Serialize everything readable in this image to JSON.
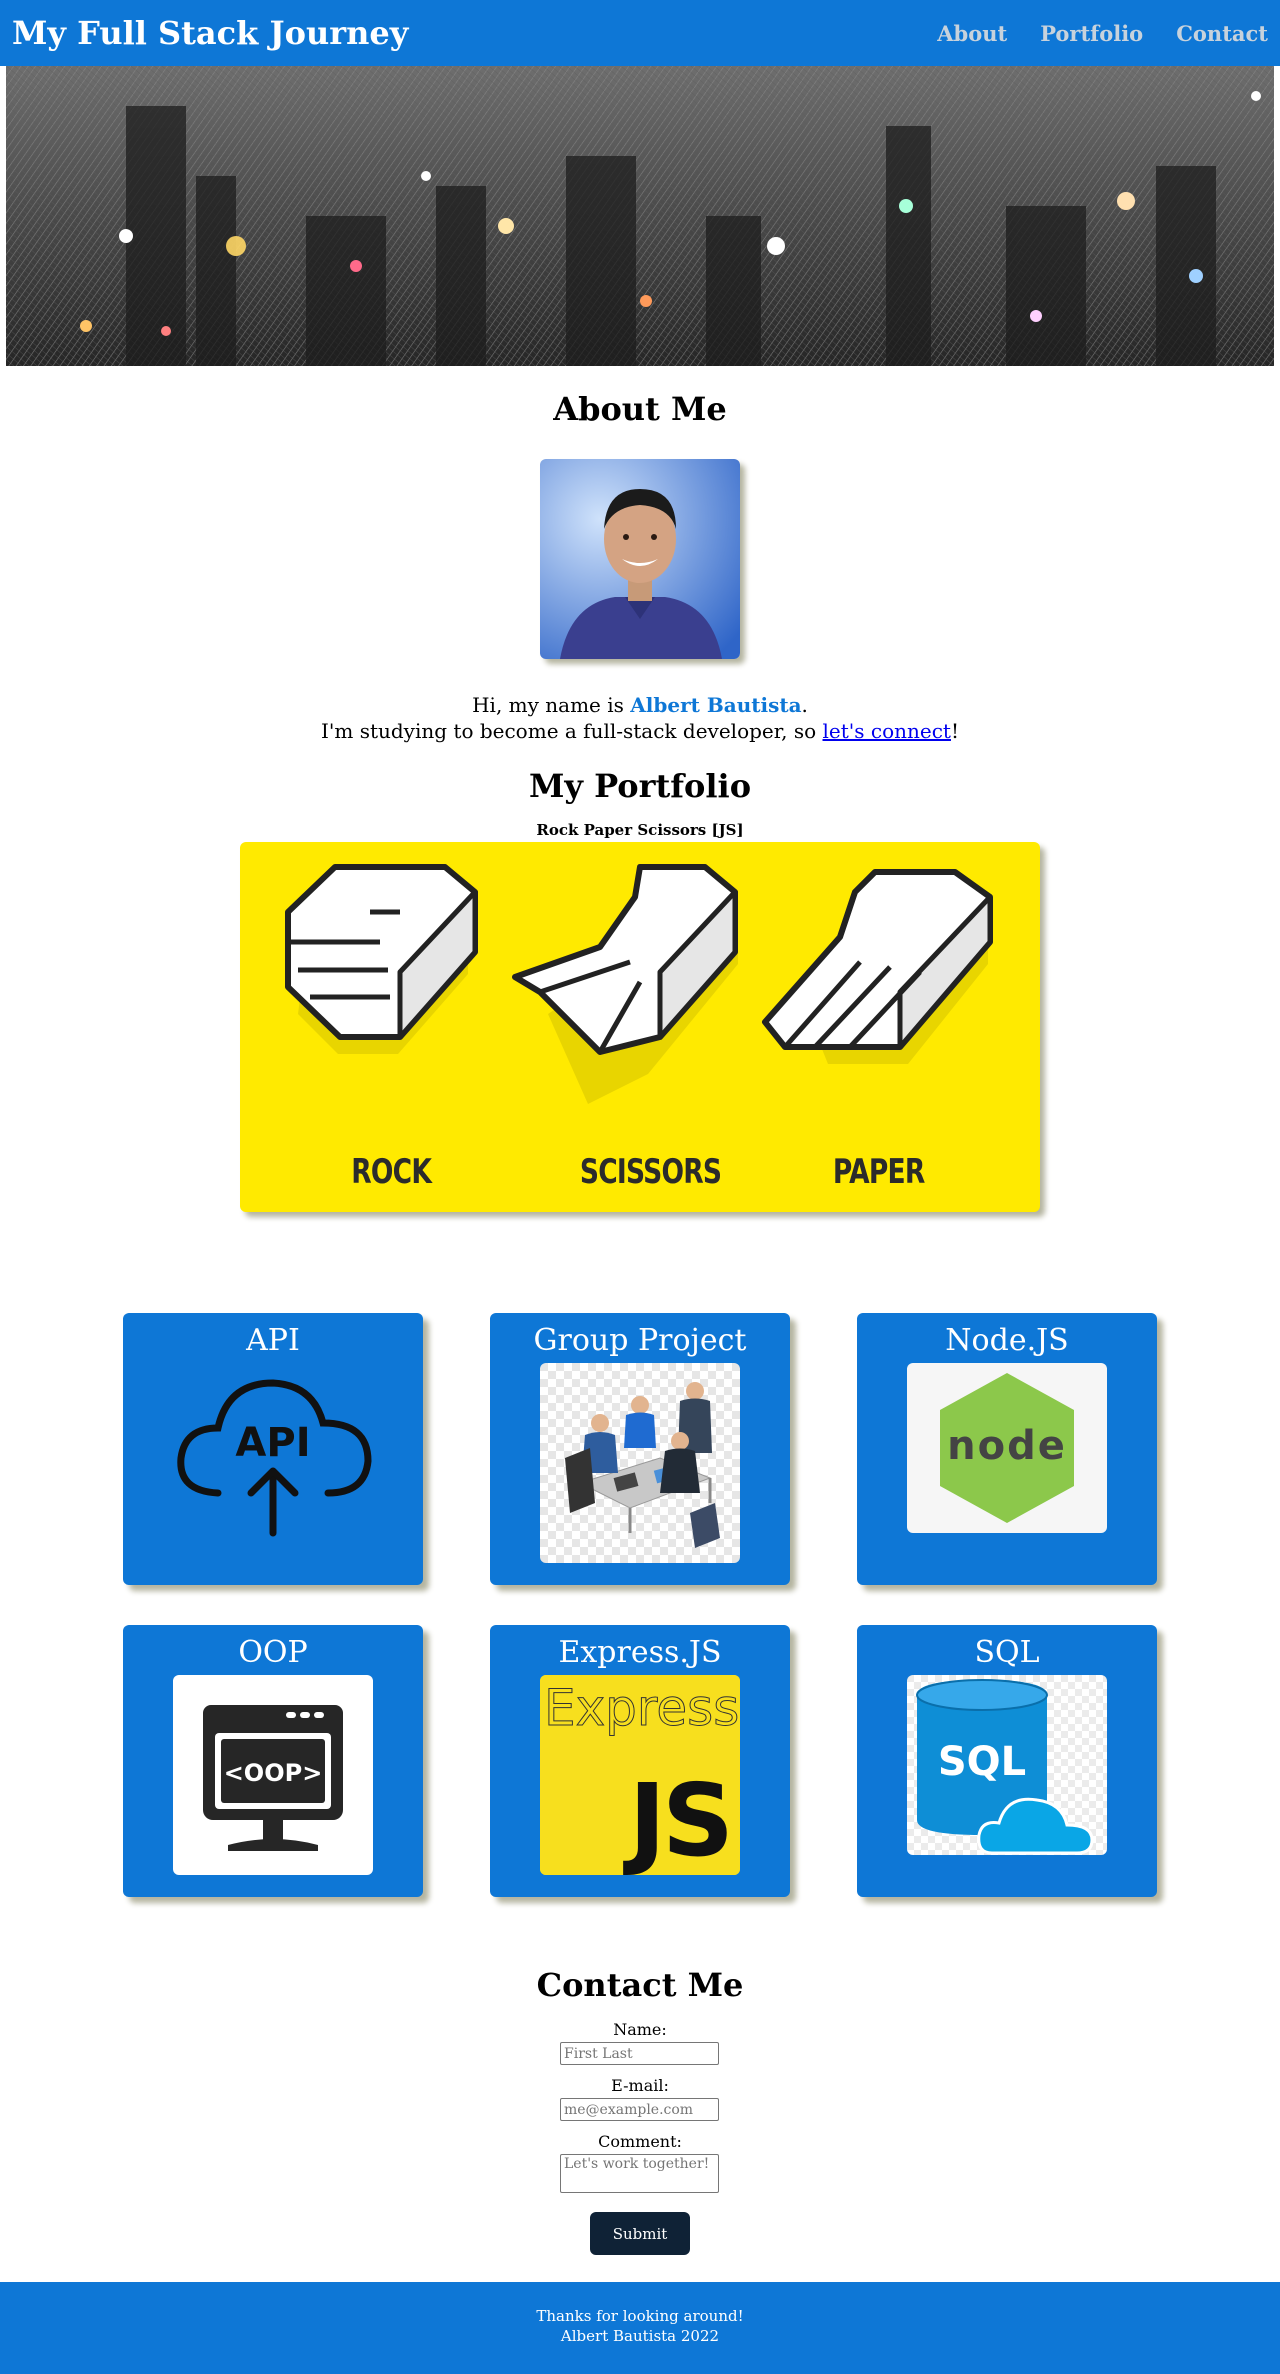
{
  "header": {
    "title": "My Full Stack Journey",
    "nav": [
      {
        "label": "About"
      },
      {
        "label": "Portfolio"
      },
      {
        "label": "Contact"
      }
    ]
  },
  "about": {
    "title": "About Me",
    "intro_prefix": "Hi, my name is ",
    "name": "Albert Bautista",
    "intro_suffix": ".",
    "line2_prefix": "I'm studying to become a full-stack developer, so ",
    "connect_link": "let's connect",
    "line2_suffix": "!"
  },
  "portfolio": {
    "title": "My Portfolio",
    "featured": {
      "caption": "Rock Paper Scissors [JS]",
      "labels": [
        "ROCK",
        "SCISSORS",
        "PAPER"
      ]
    },
    "skills": [
      {
        "label": "API"
      },
      {
        "label": "Group Project"
      },
      {
        "label": "Node.JS"
      },
      {
        "label": "OOP"
      },
      {
        "label": "Express.JS"
      },
      {
        "label": "SQL"
      }
    ],
    "icon_text": {
      "api": "API",
      "node": "node",
      "oop": "<OOP>",
      "express_word": "Express",
      "express_js": "JS",
      "sql": "SQL"
    }
  },
  "contact": {
    "title": "Contact Me",
    "name_label": "Name:",
    "name_placeholder": "First Last",
    "email_label": "E-mail:",
    "email_placeholder": "me@example.com",
    "comment_label": "Comment:",
    "comment_placeholder": "Let's work together!",
    "submit_label": "Submit"
  },
  "footer": {
    "line1": "Thanks for looking around!",
    "line2": "Albert Bautista 2022"
  },
  "colors": {
    "brand_blue": "#0e77d6",
    "rps_yellow": "#ffea00",
    "submit_dark": "#0f2236",
    "nav_text": "#c7d2dc"
  }
}
